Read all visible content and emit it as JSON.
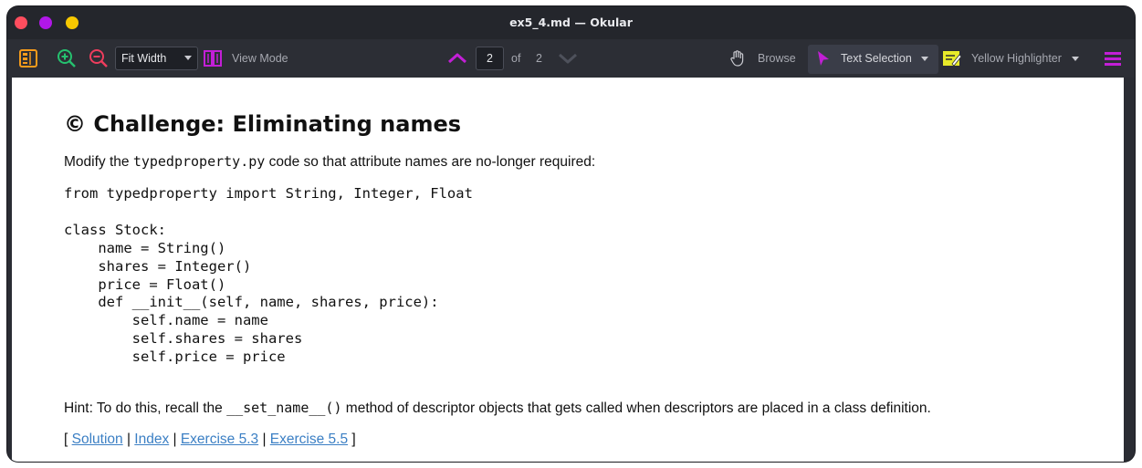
{
  "window": {
    "title": "ex5_4.md — Okular"
  },
  "toolbar": {
    "zoom_combo": "Fit Width",
    "view_mode_label": "View Mode",
    "page_current": "2",
    "page_of": "of",
    "page_total": "2",
    "browse_label": "Browse",
    "text_selection_label": "Text Selection",
    "highlighter_label": "Yellow Highlighter"
  },
  "document": {
    "heading": "© Challenge: Eliminating names",
    "intro_before": "Modify the ",
    "intro_code": "typedproperty.py",
    "intro_after": " code so that attribute names are no-longer required:",
    "code_block": "from typedproperty import String, Integer, Float\n\nclass Stock:\n    name = String()\n    shares = Integer()\n    price = Float()\n    def __init__(self, name, shares, price):\n        self.name = name\n        self.shares = shares\n        self.price = price",
    "hint_before": "Hint: To do this, recall the ",
    "hint_code": "__set_name__()",
    "hint_after": " method of descriptor objects that gets called when descriptors are placed in a class definition.",
    "nav": {
      "open": "[ ",
      "solution": "Solution",
      "sep1": " | ",
      "index": "Index",
      "sep2": " | ",
      "prev": "Exercise 5.3",
      "sep3": " | ",
      "next": "Exercise 5.5",
      "close": " ]"
    }
  },
  "colors": {
    "accent_magenta": "#c21fd6",
    "link": "#3b7fc4"
  }
}
